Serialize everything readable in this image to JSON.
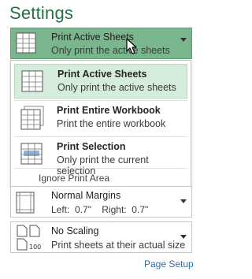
{
  "title": "Settings",
  "print_what": {
    "selected_label": "Print Active Sheets",
    "selected_desc": "Only print the active sheets",
    "options": [
      {
        "label": "Print Active Sheets",
        "desc": "Only print the active sheets",
        "highlighted": true
      },
      {
        "label": "Print Entire Workbook",
        "desc": "Print the entire workbook",
        "highlighted": false
      },
      {
        "label": "Print Selection",
        "desc": "Only print the current selection",
        "highlighted": false
      }
    ],
    "ignore_print_area": "Ignore Print Area"
  },
  "margins": {
    "label": "Normal Margins",
    "desc": "Left:  0.7\"    Right:  0.7\""
  },
  "scaling": {
    "label": "No Scaling",
    "desc": "Print sheets at their actual size",
    "icon_text": "100"
  },
  "page_setup_link": "Page Setup",
  "colors": {
    "accent_green": "#217346",
    "selected_bg": "#79b58d",
    "highlight_bg": "#d5ecdd",
    "link": "#2b6cb0"
  }
}
